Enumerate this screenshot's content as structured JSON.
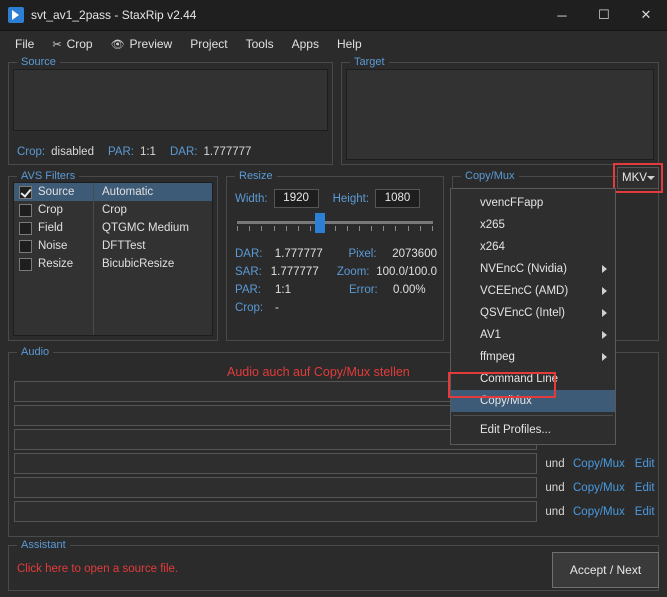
{
  "window": {
    "title": "svt_av1_2pass - StaxRip v2.44",
    "icon": "staxrip-play-icon",
    "minimize": "─",
    "maximize": "☐",
    "close": "✕"
  },
  "menubar": [
    {
      "label": "File",
      "icon": ""
    },
    {
      "label": "Crop",
      "icon": "crop-icon"
    },
    {
      "label": "Preview",
      "icon": "eye-icon"
    },
    {
      "label": "Project",
      "icon": ""
    },
    {
      "label": "Tools",
      "icon": ""
    },
    {
      "label": "Apps",
      "icon": ""
    },
    {
      "label": "Help",
      "icon": ""
    }
  ],
  "source": {
    "legend": "Source",
    "crop_label": "Crop:",
    "crop_value": "disabled",
    "par_label": "PAR:",
    "par_value": "1:1",
    "dar_label": "DAR:",
    "dar_value": "1.777777"
  },
  "target": {
    "legend": "Target"
  },
  "avs_filters": {
    "legend": "AVS Filters",
    "rows": [
      {
        "checked": true,
        "name": "Source",
        "value": "Automatic",
        "selected": true
      },
      {
        "checked": false,
        "name": "Crop",
        "value": "Crop",
        "selected": false
      },
      {
        "checked": false,
        "name": "Field",
        "value": "QTGMC Medium",
        "selected": false
      },
      {
        "checked": false,
        "name": "Noise",
        "value": "DFTTest",
        "selected": false
      },
      {
        "checked": false,
        "name": "Resize",
        "value": "BicubicResize",
        "selected": false
      }
    ]
  },
  "resize": {
    "legend": "Resize",
    "width_label": "Width:",
    "width_value": "1920",
    "height_label": "Height:",
    "height_value": "1080",
    "rows": [
      {
        "k": "DAR:",
        "v": "1.777777",
        "k2": "Pixel:",
        "v2": "2073600"
      },
      {
        "k": "SAR:",
        "v": "1.777777",
        "k2": "Zoom:",
        "v2": "100.0/100.0"
      },
      {
        "k": "PAR:",
        "v": "1:1",
        "k2": "Error:",
        "v2": "0.00%"
      },
      {
        "k": "Crop:",
        "v": "-",
        "k2": "",
        "v2": ""
      }
    ]
  },
  "codec": {
    "legend": "Copy/Mux",
    "container_value": "MKV",
    "menu": [
      {
        "label": "vvencFFapp",
        "submenu": false,
        "highlight": false
      },
      {
        "label": "x265",
        "submenu": false,
        "highlight": false
      },
      {
        "label": "x264",
        "submenu": false,
        "highlight": false
      },
      {
        "label": "NVEncC (Nvidia)",
        "submenu": true,
        "highlight": false
      },
      {
        "label": "VCEEncC (AMD)",
        "submenu": true,
        "highlight": false
      },
      {
        "label": "QSVEncC (Intel)",
        "submenu": true,
        "highlight": false
      },
      {
        "label": "AV1",
        "submenu": true,
        "highlight": false
      },
      {
        "label": "ffmpeg",
        "submenu": true,
        "highlight": false
      },
      {
        "label": "Command Line",
        "submenu": false,
        "highlight": false
      },
      {
        "label": "Copy/Mux",
        "submenu": false,
        "highlight": true
      },
      {
        "separator": true
      },
      {
        "label": "Edit Profiles...",
        "submenu": false,
        "highlight": false
      }
    ]
  },
  "audio": {
    "legend": "Audio",
    "note": "Audio auch auf Copy/Mux stellen",
    "rows": [
      {
        "lang": "",
        "profile": "ux",
        "edit": "Edit"
      },
      {
        "lang": "",
        "profile": "ux",
        "edit": "Edit"
      },
      {
        "lang": "",
        "profile": "ux",
        "edit": "Edit"
      },
      {
        "lang": "und",
        "profile": "Copy/Mux",
        "edit": "Edit"
      },
      {
        "lang": "und",
        "profile": "Copy/Mux",
        "edit": "Edit"
      },
      {
        "lang": "und",
        "profile": "Copy/Mux",
        "edit": "Edit"
      }
    ]
  },
  "assistant": {
    "legend": "Assistant",
    "message": "Click here to open a source file."
  },
  "accept_button": {
    "label": "Accept / Next"
  },
  "colors": {
    "accent_blue": "#5b9ad6",
    "link_blue": "#4a9ae0",
    "highlight_red": "#e33b3b",
    "selection": "#3d5a77",
    "window_bg": "#2b2b2b",
    "panel_bg": "#323232"
  }
}
